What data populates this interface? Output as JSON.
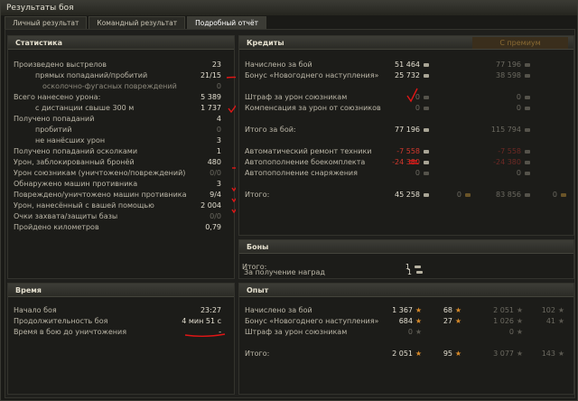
{
  "window": {
    "title": "Результаты боя"
  },
  "tabs": [
    {
      "label": "Личный результат"
    },
    {
      "label": "Командный результат"
    },
    {
      "label": "Подробный отчёт"
    }
  ],
  "stats": {
    "header": "Статистика",
    "rows": [
      {
        "label": "Произведено выстрелов",
        "value": "23"
      },
      {
        "label": "прямых попаданий/пробитий",
        "value": "21/15"
      },
      {
        "label": "осколочно-фугасных повреждений",
        "value": "0"
      },
      {
        "label": "Всего нанесено урона:",
        "value": "5 389"
      },
      {
        "label": "с дистанции свыше 300 м",
        "value": "1 737"
      },
      {
        "label": "Получено попаданий",
        "value": "4"
      },
      {
        "label": "пробитий",
        "value": "0"
      },
      {
        "label": "не нанёсших урон",
        "value": "3"
      },
      {
        "label": "Получено попаданий осколками",
        "value": "1"
      },
      {
        "label": "Урон, заблокированный бронёй",
        "value": "480"
      },
      {
        "label": "Урон союзникам (уничтожено/повреждений)",
        "value": "0/0"
      },
      {
        "label": "Обнаружено машин противника",
        "value": "3"
      },
      {
        "label": "Повреждено/уничтожено машин противника",
        "value": "9/4"
      },
      {
        "label": "Урон, нанесённый с вашей помощью",
        "value": "2 004"
      },
      {
        "label": "Очки захвата/защиты базы",
        "value": "0/0"
      },
      {
        "label": "Пройдено километров",
        "value": "0,79"
      }
    ]
  },
  "time": {
    "header": "Время",
    "rows": [
      {
        "label": "Начало боя",
        "value": "23:27"
      },
      {
        "label": "Продолжительность боя",
        "value": "4 мин 51 с"
      },
      {
        "label": "Время в бою до уничтожения",
        "value": "-"
      }
    ]
  },
  "credits": {
    "header": "Кредиты",
    "premium_label": "С премиум",
    "rows": [
      {
        "label": "Начислено за бой",
        "value": "51 464",
        "premium": "77 196"
      },
      {
        "label": "Бонус «Новогоднего наступления»",
        "value": "25 732",
        "premium": "38 598"
      },
      {
        "label": "Штраф за урон союзникам",
        "value": "0",
        "premium": "0"
      },
      {
        "label": "Компенсация за урон от союзников",
        "value": "0",
        "premium": "0"
      },
      {
        "label": "Итого за бой:",
        "value": "77 196",
        "premium": "115 794"
      },
      {
        "label": "Автоматический ремонт техники",
        "value": "-7 558",
        "premium": "-7 558"
      },
      {
        "label": "Автопополнение боекомплекта",
        "value": "-24 380",
        "premium": "-24 380"
      },
      {
        "label": "Автопополнение снаряжения",
        "value": "0",
        "premium": "0"
      },
      {
        "label": "Итого:",
        "value": "45 258",
        "value2": "0",
        "premium": "83 856",
        "premium2": "0"
      }
    ]
  },
  "bonds": {
    "header": "Боны",
    "rows": [
      {
        "label": "За получение наград",
        "value": "1"
      },
      {
        "label": "Итого:",
        "value": "1"
      }
    ]
  },
  "experience": {
    "header": "Опыт",
    "rows": [
      {
        "label": "Начислено за бой",
        "xp": "1 367",
        "free": "68",
        "pxp": "2 051",
        "pfree": "102"
      },
      {
        "label": "Бонус «Новогоднего наступления»",
        "xp": "684",
        "free": "27",
        "pxp": "1 026",
        "pfree": "41"
      },
      {
        "label": "Штраф за урон союзникам",
        "xp": "0",
        "free": "",
        "pxp": "0",
        "pfree": ""
      },
      {
        "label": "Итого:",
        "xp": "2 051",
        "free": "95",
        "pxp": "3 077",
        "pfree": "143"
      }
    ]
  },
  "colors": {
    "accent_red": "#e01616",
    "premium_gold": "#8a6a33",
    "negative": "#d0382d"
  }
}
